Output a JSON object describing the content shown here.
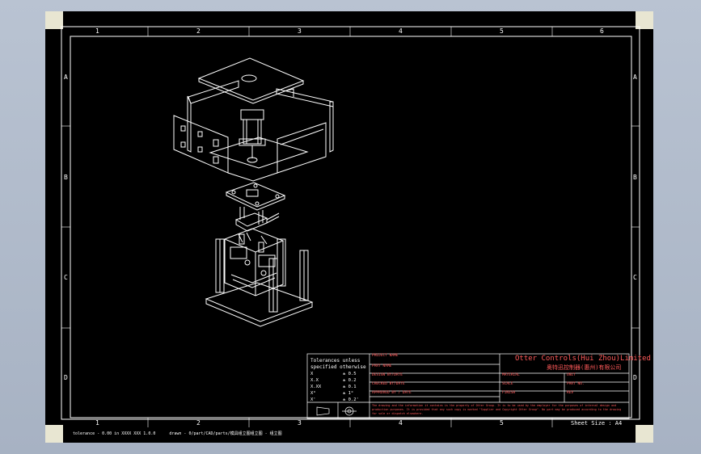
{
  "ruler": {
    "columns": [
      "1",
      "2",
      "3",
      "4",
      "5",
      "6"
    ],
    "rows": [
      "A",
      "B",
      "C",
      "D"
    ]
  },
  "title_block": {
    "tolerance_title": "Tolerances unless\nspecified otherwise",
    "tolerances": [
      {
        "k": "X",
        "v": "± 0.5"
      },
      {
        "k": "X.X",
        "v": "± 0.2"
      },
      {
        "k": "X.XX",
        "v": "± 0.1"
      },
      {
        "k": "X°",
        "v": "± 1°"
      },
      {
        "k": "X'",
        "v": "± 0.2'"
      }
    ],
    "labels": {
      "project_name": "PROJECT NAME",
      "part_name": "PART NAME",
      "design_by": "DESIGN BY/DATE",
      "checked_by": "CHECKED BY/DATE",
      "approved_by": "APPROVED BY / DATE",
      "material": "MATERIAL",
      "scale": "SCALE",
      "finish": "FINISH",
      "unit": "UNIT",
      "part_no": "PART NO.",
      "rev": "REV"
    },
    "company": "Otter Controls(Hui Zhou)Limited",
    "company_cn": "奥特迅控制器(惠州)有限公司",
    "notice": "The drawing and the information it contains is the property of Otter Group. It is to be used by the employer for the purposes of internal design and production purposes. It is provided that any such copy is marked \"Supplier and Copyright Otter Group\". No part may be produced according to the drawing for sale or dispatch elsewhere.",
    "sheet_size": "Sheet Size : A4"
  },
  "statusbar": {
    "left": "tolerance - 0.00 in XXXX XXX 1.0.0",
    "right": "drawn - 0/part/CAD/parts/模具组立图组立图 - 组立图"
  },
  "colors": {
    "frame": "#ffffff",
    "title_text": "#ff5a5a",
    "sheet": "#000000",
    "background": "#b9c3d2"
  }
}
